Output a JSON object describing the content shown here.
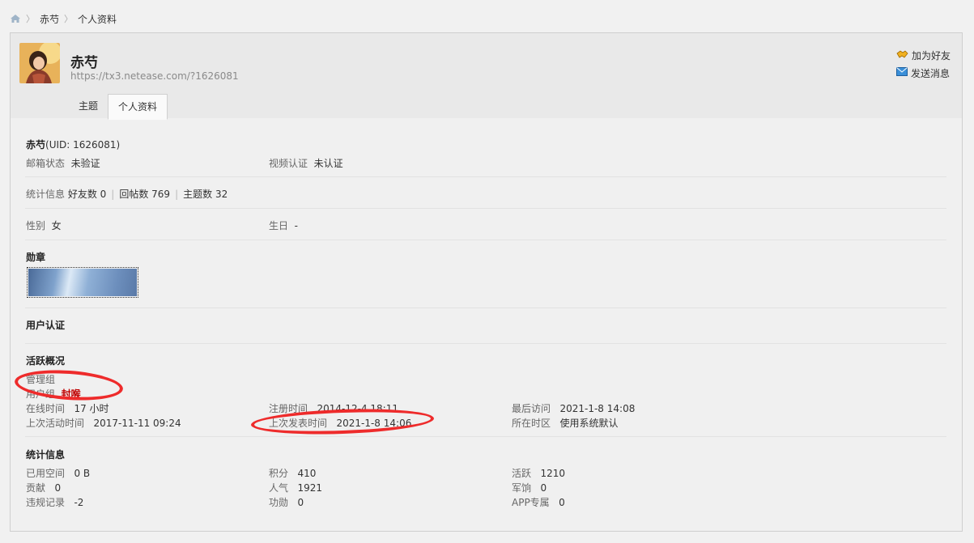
{
  "breadcrumb": {
    "items": [
      "赤芍",
      "个人资料"
    ]
  },
  "header": {
    "username": "赤芍",
    "url": "https://tx3.netease.com/?1626081",
    "add_friend": "加为好友",
    "send_message": "发送消息"
  },
  "tabs": [
    "主题",
    "个人资料"
  ],
  "profile": {
    "name": "赤芍",
    "uid_text": "(UID: 1626081)",
    "email_status_label": "邮箱状态",
    "email_status_value": "未验证",
    "video_auth_label": "视频认证",
    "video_auth_value": "未认证",
    "stats_label": "统计信息",
    "friends": "好友数 0",
    "replies": "回帖数 769",
    "topics": "主题数 32",
    "gender_label": "性别",
    "gender_value": "女",
    "birthday_label": "生日",
    "birthday_value": "-"
  },
  "sections": {
    "medals": "勋章",
    "user_auth": "用户认证",
    "activity": "活跃概况",
    "statistics": "统计信息"
  },
  "activity": {
    "admin_group_label": "管理组",
    "user_group_label": "用户组",
    "user_group_value": "封喉",
    "online_label": "在线时间",
    "online_value": "17 小时",
    "register_label": "注册时间",
    "register_value": "2014-12-4 18:11",
    "last_visit_label": "最后访问",
    "last_visit_value": "2021-1-8 14:08",
    "last_active_label": "上次活动时间",
    "last_active_value": "2017-11-11 09:24",
    "last_post_label": "上次发表时间",
    "last_post_value": "2021-1-8 14:06",
    "timezone_label": "所在时区",
    "timezone_value": "使用系统默认"
  },
  "statistics": {
    "space_label": "已用空间",
    "space_value": "0 B",
    "points_label": "积分",
    "points_value": "410",
    "active_label": "活跃",
    "active_value": "1210",
    "contribution_label": "贡献",
    "contribution_value": "0",
    "popularity_label": "人气",
    "popularity_value": "1921",
    "pay_label": "军饷",
    "pay_value": "0",
    "violations_label": "违规记录",
    "violations_value": "-2",
    "merit_label": "功勋",
    "merit_value": "0",
    "app_label": "APP专属",
    "app_value": "0"
  },
  "colors": {
    "banned": "#c00000",
    "annotation": "#ee2b2b"
  }
}
